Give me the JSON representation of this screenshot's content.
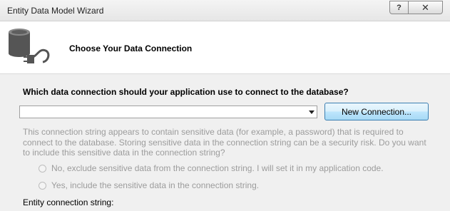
{
  "window": {
    "title": "Entity Data Model Wizard",
    "help_label": "?",
    "close_label": "✕"
  },
  "header": {
    "title": "Choose Your Data Connection",
    "icon": "database-plug-icon"
  },
  "main": {
    "question": "Which data connection should your application use to connect to the database?",
    "connection_combo": {
      "value": ""
    },
    "new_connection_label": "New Connection...",
    "sensitive_message": "This connection string appears to contain sensitive data (for example, a password) that is required to connect to the database. Storing sensitive data in the connection string can be a security risk. Do you want to include this sensitive data in the connection string?",
    "radio_no_label": "No, exclude sensitive data from the connection string. I will set it in my application code.",
    "radio_yes_label": "Yes, include the sensitive data in the connection string.",
    "entity_conn_label": "Entity connection string:"
  },
  "colors": {
    "disabled_text": "#9c9c9c",
    "button_border": "#3c7fb1"
  }
}
